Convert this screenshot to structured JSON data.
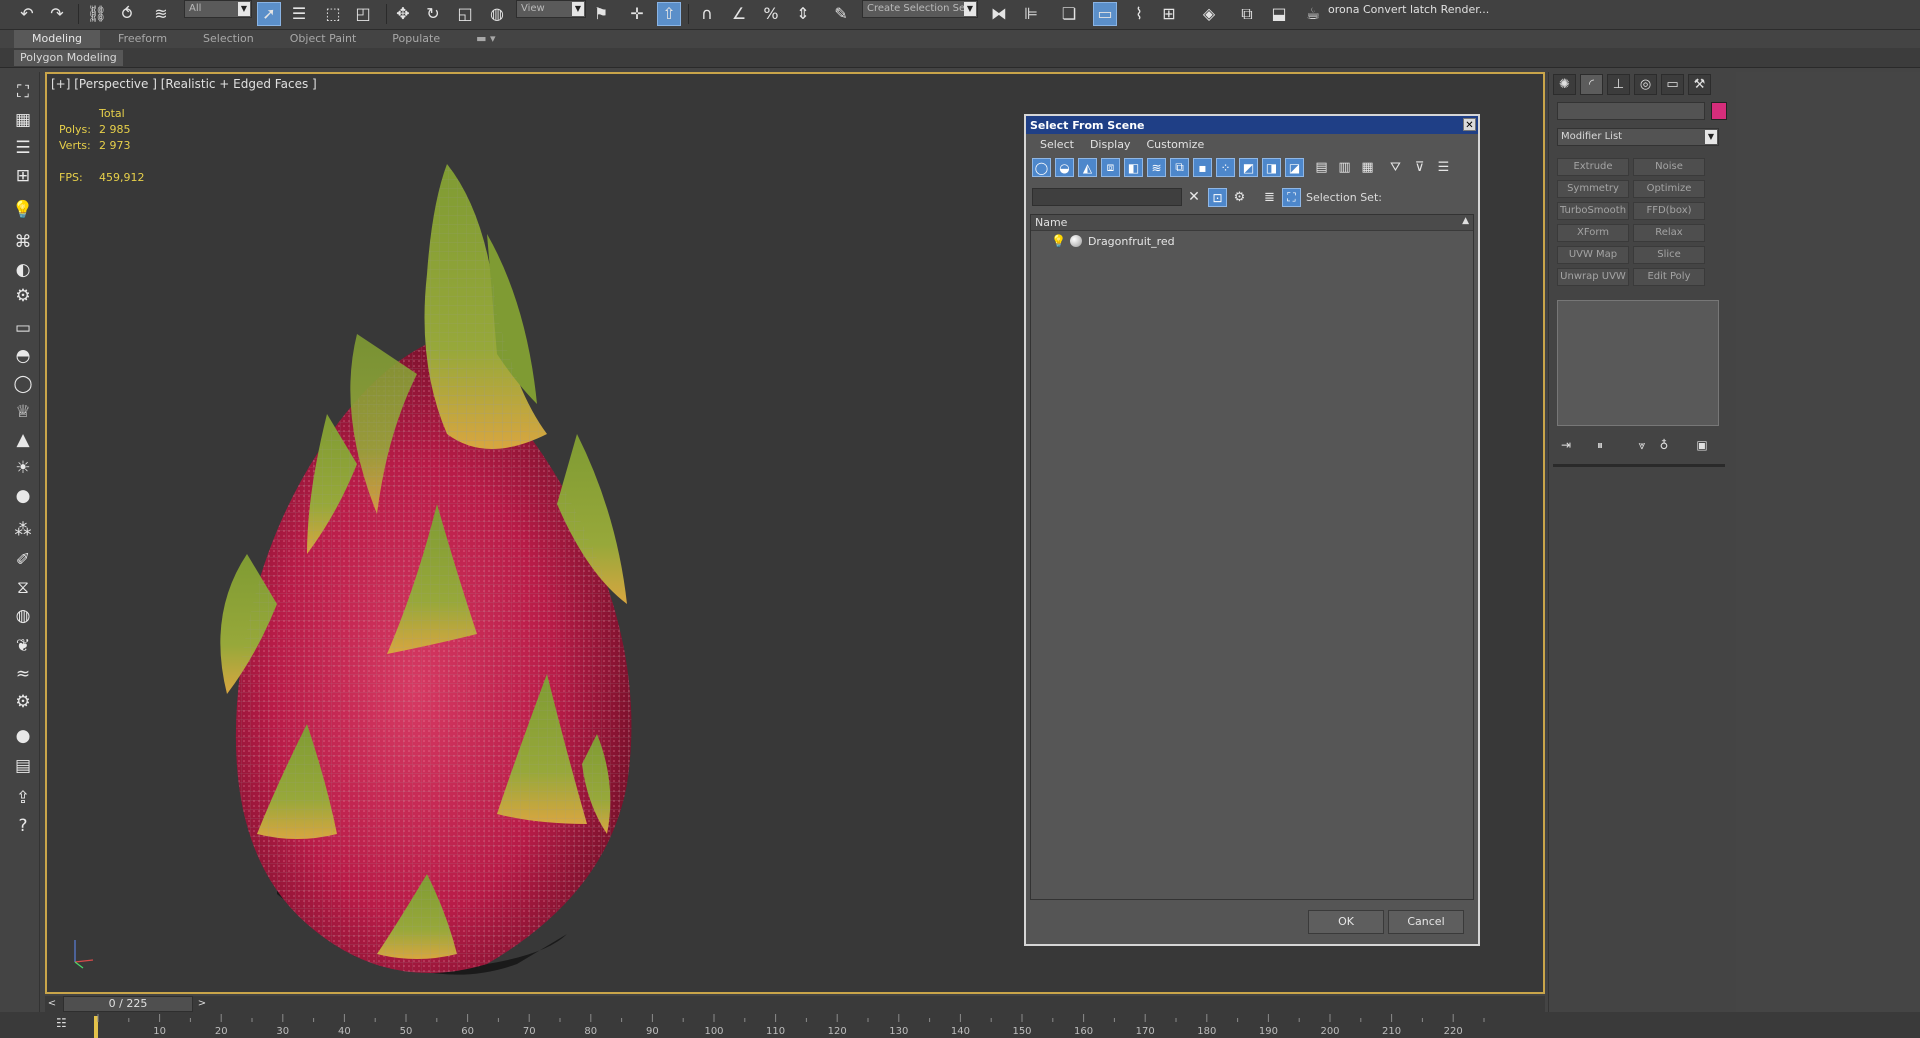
{
  "app": {
    "render_text": "orona Convert latch Render...",
    "filter_selection": "All",
    "reference_coord": "View",
    "named_selection": "Create Selection Se"
  },
  "ribbon": {
    "tabs": [
      "Modeling",
      "Freeform",
      "Selection",
      "Object Paint",
      "Populate"
    ],
    "active_tab": "Modeling",
    "sub_label": "Polygon Modeling"
  },
  "viewport": {
    "label": "[+] [Perspective ] [Realistic + Edged Faces ]",
    "stats": {
      "header": "Total",
      "polys_label": "Polys:",
      "polys_value": "2 985",
      "verts_label": "Verts:",
      "verts_value": "2 973",
      "fps_label": "FPS:",
      "fps_value": "459,912"
    }
  },
  "dialog": {
    "title": "Select From Scene",
    "menu": [
      "Select",
      "Display",
      "Customize"
    ],
    "selection_set_label": "Selection Set:",
    "column_header": "Name",
    "items": [
      "Dragonfruit_red"
    ],
    "ok_label": "OK",
    "cancel_label": "Cancel"
  },
  "command_panel": {
    "modifier_list": "Modifier List",
    "modifiers": [
      "Extrude",
      "Noise",
      "Symmetry",
      "Optimize",
      "TurboSmooth",
      "FFD(box)",
      "XForm",
      "Relax",
      "UVW Map",
      "Slice",
      "Unwrap UVW",
      "Edit Poly"
    ],
    "object_color": "#d62d7b"
  },
  "timeline": {
    "frame_display": "0 / 225",
    "ticks": [
      "10",
      "20",
      "30",
      "40",
      "50",
      "60",
      "70",
      "80",
      "90",
      "100",
      "110",
      "120",
      "130",
      "140",
      "150",
      "160",
      "170",
      "180",
      "190",
      "200",
      "210",
      "220"
    ]
  },
  "colors": {
    "viewport_border": "#c9a54a",
    "stats_text": "#e7d04a",
    "accent_blue": "#4d87cb"
  }
}
